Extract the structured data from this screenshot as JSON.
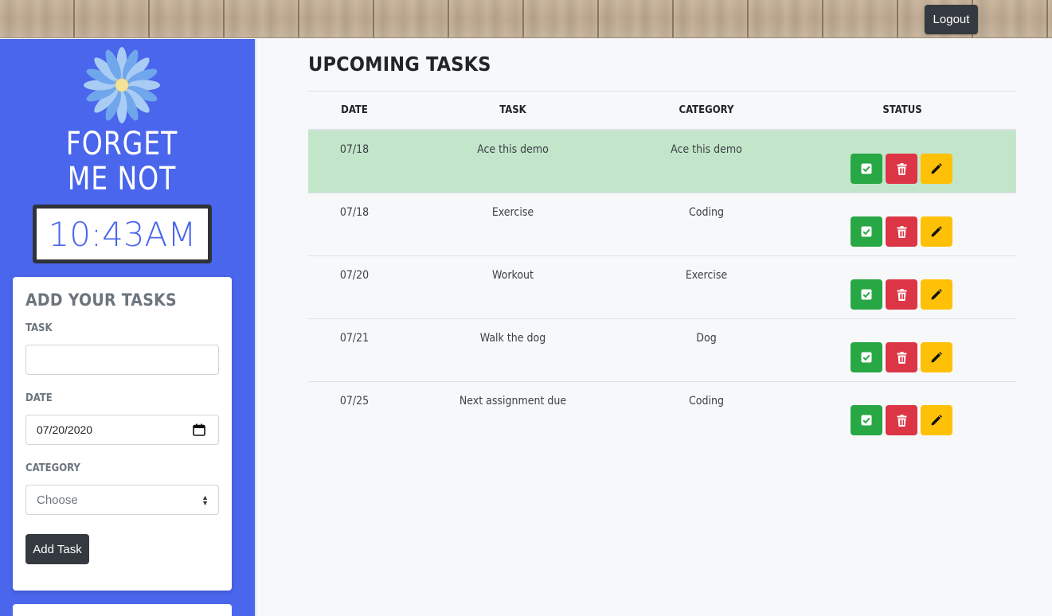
{
  "header": {
    "logout_label": "Logout"
  },
  "sidebar": {
    "brand_line1": "FORGET",
    "brand_line2": "ME NOT",
    "clock": "10:43AM",
    "form": {
      "title": "ADD YOUR TASKS",
      "task_label": "TASK",
      "task_value": "",
      "date_label": "DATE",
      "date_value": "07/20/2020",
      "category_label": "CATEGORY",
      "category_selected": "Choose",
      "submit_label": "Add Task"
    }
  },
  "main": {
    "title": "UPCOMING TASKS",
    "columns": [
      "DATE",
      "TASK",
      "CATEGORY",
      "STATUS"
    ],
    "rows": [
      {
        "date": "07/18",
        "task": "Ace this demo",
        "category": "Ace this demo",
        "highlighted": true
      },
      {
        "date": "07/18",
        "task": "Exercise",
        "category": "Coding",
        "highlighted": false
      },
      {
        "date": "07/20",
        "task": "Workout",
        "category": "Exercise",
        "highlighted": false
      },
      {
        "date": "07/21",
        "task": "Walk the dog",
        "category": "Dog",
        "highlighted": false
      },
      {
        "date": "07/25",
        "task": "Next assignment due",
        "category": "Coding",
        "highlighted": false
      }
    ],
    "row_actions": [
      "check-icon",
      "trash-icon",
      "pencil-icon"
    ]
  },
  "colors": {
    "sidebar_bg": "#4a66ec",
    "success": "#28a745",
    "danger": "#dc3545",
    "warning": "#ffc107",
    "highlight_row": "#c3e6cb",
    "dark_button": "#343a40"
  }
}
